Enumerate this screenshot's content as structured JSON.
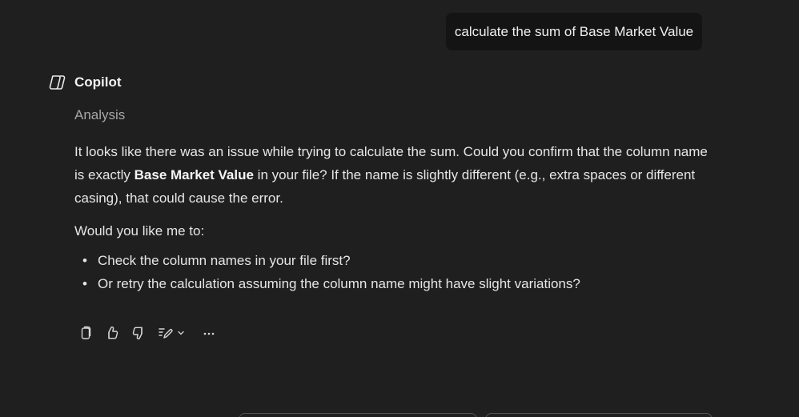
{
  "user_message": {
    "text": "calculate the sum of Base Market Value"
  },
  "assistant": {
    "name": "Copilot",
    "logo_icon": "copilot-logo-icon",
    "status_label": "Analysis",
    "paragraph1": {
      "before": "It looks like there was an issue while trying to calculate the sum. Could you confirm that the column name is exactly ",
      "bold": "Base Market Value",
      "after": " in your file? If the name is slightly different (e.g., extra spaces or different casing), that could cause the error."
    },
    "paragraph2": "Would you like me to:",
    "bullets": [
      "Check the column names in your file first?",
      "Or retry the calculation assuming the column name might have slight variations?"
    ]
  },
  "actions": {
    "icons": [
      "copy-icon",
      "thumbs-up-icon",
      "thumbs-down-icon",
      "edit-icon",
      "chevron-down-icon",
      "more-icon"
    ]
  },
  "colors": {
    "background": "#1f1f1f",
    "user_bubble": "#141414",
    "text": "#e6e6e6",
    "muted": "#a6a6a6"
  }
}
